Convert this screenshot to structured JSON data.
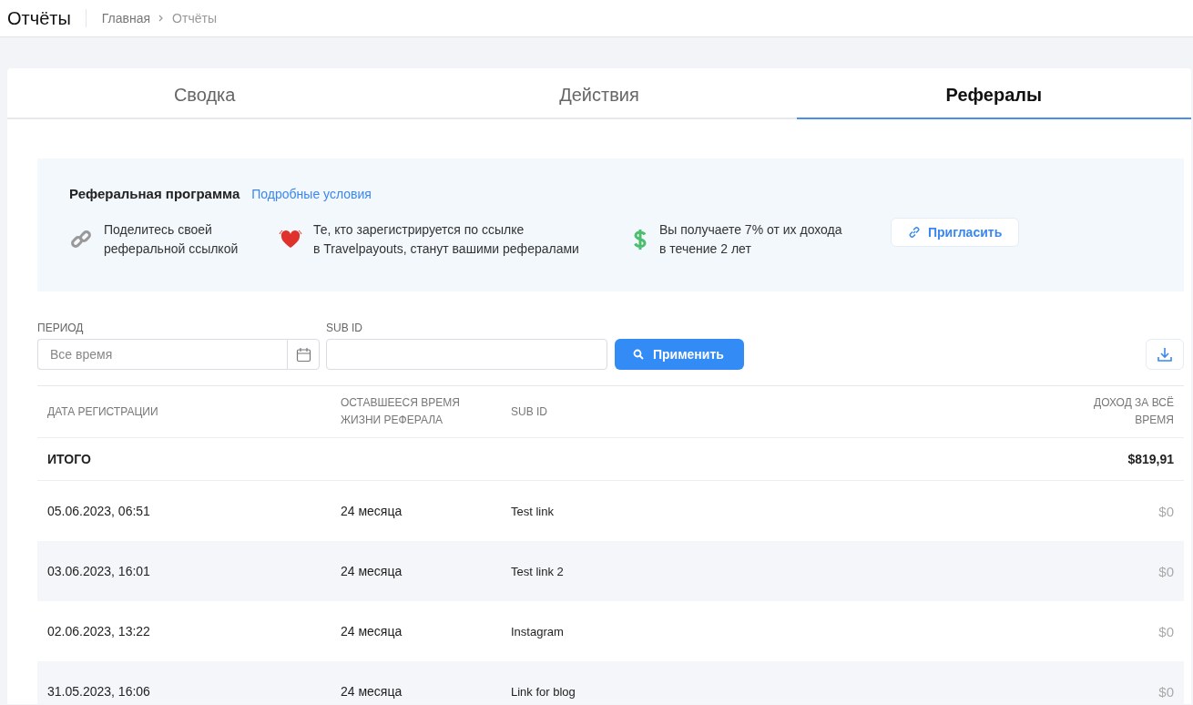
{
  "header": {
    "title": "Отчёты",
    "breadcrumbs": [
      "Главная",
      "Отчёты"
    ]
  },
  "tabs": [
    {
      "label": "Сводка",
      "selected": false
    },
    {
      "label": "Действия",
      "selected": false
    },
    {
      "label": "Рефералы",
      "selected": true
    }
  ],
  "banner": {
    "title": "Реферальная программа",
    "link": "Подробные условия",
    "steps": [
      {
        "kind": "link",
        "text": [
          "Поделитесь своей",
          "реферальной ссылкой"
        ]
      },
      {
        "kind": "heart",
        "text": [
          "Те, кто зарегистрируется по ссылке",
          "в Travelpayouts, станут вашими рефералами"
        ]
      },
      {
        "kind": "dollar",
        "text": [
          "Вы получаете 7% от их дохода",
          "в течение 2 лет"
        ]
      }
    ],
    "button": "Пригласить"
  },
  "filters": {
    "period": {
      "label": "ПЕРИОД",
      "placeholder": "Все время"
    },
    "sub_id": {
      "label": "SUB ID"
    },
    "apply": "Применить"
  },
  "table": {
    "columns": [
      "ДАТА РЕГИСТРАЦИИ",
      "ОСТАВШЕЕСЯ ВРЕМЯ ЖИЗНИ РЕФЕРАЛА",
      "SUB ID",
      "ДОХОД ЗА ВСЁ ВРЕМЯ"
    ],
    "total": {
      "label": "ИТОГО",
      "value": "$819,91"
    },
    "rows": [
      {
        "date": "05.06.2023, 06:51",
        "lifetime": "24 месяца",
        "sub_id": "Test link",
        "income": "$0"
      },
      {
        "date": "03.06.2023, 16:01",
        "lifetime": "24 месяца",
        "sub_id": "Test link 2",
        "income": "$0"
      },
      {
        "date": "02.06.2023, 13:22",
        "lifetime": "24 месяца",
        "sub_id": "Instagram",
        "income": "$0"
      },
      {
        "date": "31.05.2023, 16:06",
        "lifetime": "24 месяца",
        "sub_id": "Link for blog",
        "income": "$0"
      }
    ]
  }
}
